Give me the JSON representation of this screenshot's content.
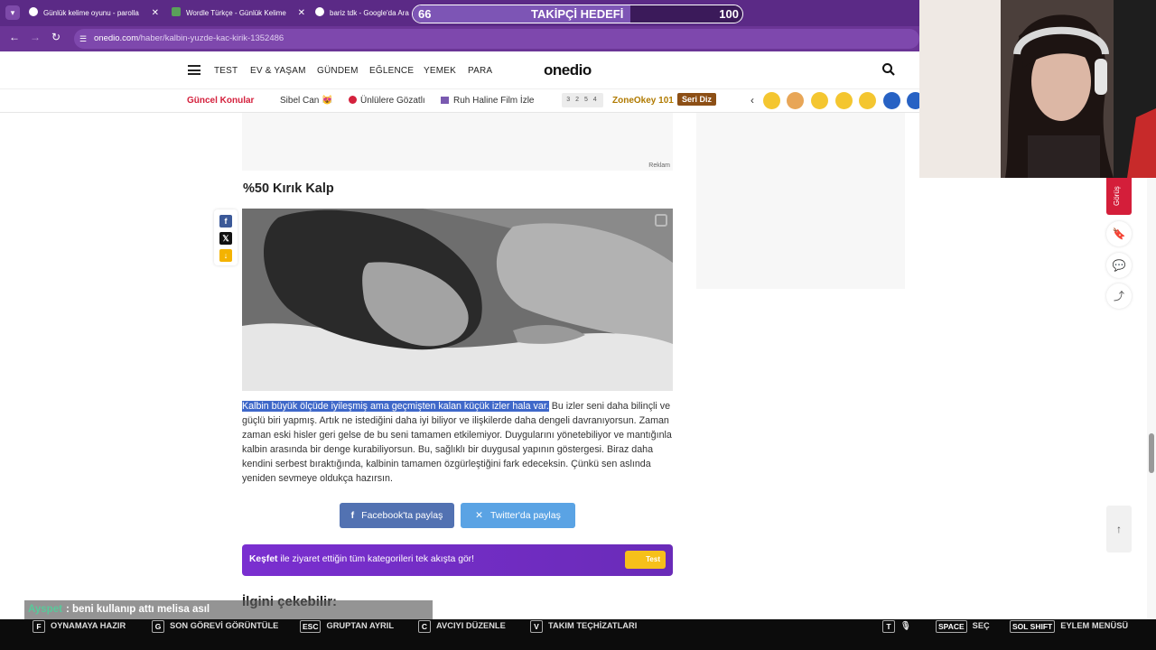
{
  "browser": {
    "tabs": [
      {
        "title": "Günlük kelime oyunu - parolla"
      },
      {
        "title": "Wordle Türkçe - Günlük Kelime"
      },
      {
        "title": "bariz tdk - Google'da Ara"
      }
    ],
    "url_host": "onedio.com",
    "url_path": "/haber/kalbin-yuzde-kac-kirik-1352486"
  },
  "overlay_goal": {
    "current": "66",
    "label": "TAKİPÇİ HEDEFİ",
    "target": "100",
    "progress_fraction": 0.66
  },
  "site": {
    "logo": "onedio",
    "nav": [
      "TEST",
      "EV & YAŞAM",
      "GÜNDEM",
      "EĞLENCE",
      "YEMEK",
      "PARA"
    ],
    "trending_label": "Güncel Konular",
    "trending": [
      "Sibel Can 😻",
      "Ünlülere Gözatlı",
      "Ruh Haline Film İzle"
    ],
    "number_box": "3 2 5 4",
    "zone": "ZoneOkey 101",
    "seri": "Seri Diz",
    "colors": {
      "accent_red": "#d4213d",
      "purple": "#6b3596"
    }
  },
  "article": {
    "ad_label": "Reklam",
    "section_title": "%50 Kırık Kalp",
    "highlighted": "Kalbin büyük ölçüde iyileşmiş ama geçmişten kalan küçük izler hala var.",
    "paragraph": " Bu izler seni daha bilinçli ve güçlü biri yapmış. Artık ne istediğini daha iyi biliyor ve ilişkilerde daha dengeli davranıyorsun. Zaman zaman eski hisler geri gelse de bu seni tamamen etkilemiyor. Duygularını yönetebiliyor ve mantığınla kalbin arasında bir denge kurabiliyorsun. Bu, sağlıklı bir duygusal yapının göstergesi. Biraz daha kendini serbest bıraktığında, kalbinin tamamen özgürleştiğini fark edeceksin. Çünkü sen aslında yeniden sevmeye oldukça hazırsın.",
    "facebook_share": "Facebook'ta paylaş",
    "twitter_share": "Twitter'da paylaş",
    "kesfet_bold": "Keşfet",
    "kesfet_rest": " ile ziyaret ettiğin tüm kategorileri tek akışta gör!",
    "kesfet_tag": "Test",
    "related_title": "İlgini çekebilir:",
    "side_tab": "Görüş"
  },
  "chat": {
    "user": "Ayspet",
    "message": ": beni kullanıp attı melisa asıl"
  },
  "hud": [
    {
      "key": "F",
      "label": "OYNAMAYA HAZIR"
    },
    {
      "key": "G",
      "label": "SON GÖREVİ GÖRÜNTÜLE"
    },
    {
      "key": "ESC",
      "label": "GRUPTAN AYRIL"
    },
    {
      "key": "C",
      "label": "AVCIYI DÜZENLE"
    },
    {
      "key": "V",
      "label": "TAKIM TEÇHİZATLARI"
    },
    {
      "key": "T",
      "label": ""
    },
    {
      "key": "SPACE",
      "label": "SEÇ"
    },
    {
      "key": "SOL SHIFT",
      "label": "EYLEM MENÜSÜ"
    }
  ]
}
